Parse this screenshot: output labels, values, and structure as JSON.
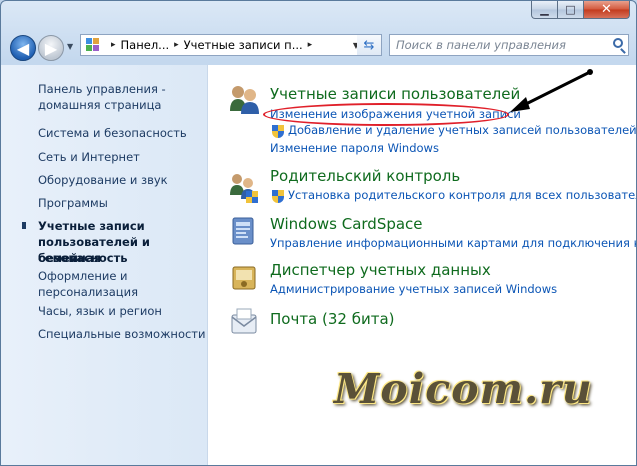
{
  "window": {
    "caption": {
      "minimize": "▁",
      "maximize": "□",
      "close": "✕"
    }
  },
  "toolbar": {
    "breadcrumb": [
      "Панел...",
      "Учетные записи п...",
      ""
    ],
    "search_placeholder": "Поиск в панели управления"
  },
  "sidebar": {
    "items": [
      {
        "label": "Панель управления -"
      },
      {
        "label": "домашняя страница"
      },
      {
        "label": "Система и безопасность"
      },
      {
        "label": "Сеть и Интернет"
      },
      {
        "label": "Оборудование и звук"
      },
      {
        "label": "Программы"
      },
      {
        "label": "Учетные записи"
      },
      {
        "label": "пользователей и семейная"
      },
      {
        "label": "безопасность"
      },
      {
        "label": "Оформление и"
      },
      {
        "label": "персонализация"
      },
      {
        "label": "Часы, язык и регион"
      },
      {
        "label": "Специальные возможности"
      }
    ]
  },
  "main": {
    "categories": [
      {
        "title": "Учетные записи пользователей",
        "links": [
          "Изменение изображения учетной записи",
          "Добавление и удаление учетных записей пользователей",
          "Изменение пароля Windows"
        ]
      },
      {
        "title": "Родительский контроль",
        "links": [
          "Установка родительского контроля для всех пользователей"
        ]
      },
      {
        "title": "Windows CardSpace",
        "links": [
          "Управление информационными картами для подключения к с"
        ]
      },
      {
        "title": "Диспетчер учетных данных",
        "links": [
          "Администрирование учетных записей Windows"
        ]
      },
      {
        "title": "Почта (32 бита)",
        "links": []
      }
    ]
  },
  "watermark": "Moicom.ru"
}
